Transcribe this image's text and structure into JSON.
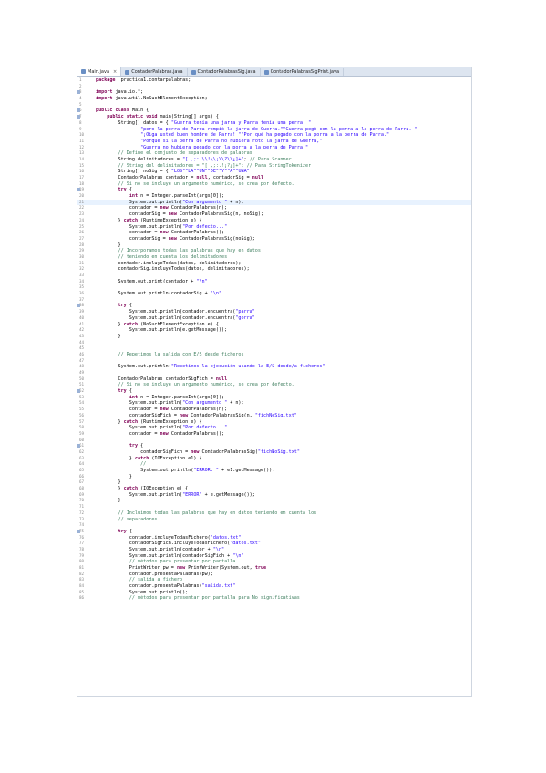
{
  "tabs": [
    {
      "label": "Main.java",
      "close": "×"
    },
    {
      "label": "ContadorPalabras.java"
    },
    {
      "label": "ContadorPalabrasSig.java"
    },
    {
      "label": "ContadorPalabrasSigPrint.java"
    }
  ],
  "lines": [
    {
      "n": "1",
      "t": [
        [
          "kw",
          "package"
        ],
        [
          "",
          "  practica1.contarpalabras;"
        ]
      ]
    },
    {
      "n": "2",
      "t": []
    },
    {
      "n": "3",
      "t": [
        [
          "kw",
          "import"
        ],
        [
          "",
          " java.io.*;"
        ]
      ],
      "m": true
    },
    {
      "n": "4",
      "t": [
        [
          "kw",
          "import"
        ],
        [
          "",
          " java.util.NoSuchElementException;"
        ]
      ]
    },
    {
      "n": "5",
      "t": []
    },
    {
      "n": "6",
      "t": [
        [
          "kw",
          "public class"
        ],
        [
          "",
          " Main {"
        ]
      ],
      "m": true
    },
    {
      "n": "7",
      "t": [
        [
          "",
          "    "
        ],
        [
          "kw",
          "public static void"
        ],
        [
          "",
          " main(String[] args) {"
        ]
      ],
      "m": true
    },
    {
      "n": "8",
      "t": [
        [
          "",
          "        String[] datos = { "
        ],
        [
          "str",
          "\"Guerra tenía una jarra y Parra tenía una perra. \""
        ],
        [
          ","
        ]
      ]
    },
    {
      "n": "9",
      "t": [
        [
          "",
          "                "
        ],
        [
          "str",
          "\"pero la perra de Parra rompió la jarra de Guerra.\""
        ],
        [
          ", "
        ],
        [
          "str",
          "\"Guerra pegó con la porra a la perra de Parra. \""
        ],
        [
          ","
        ]
      ]
    },
    {
      "n": "10",
      "t": [
        [
          "",
          "                "
        ],
        [
          "str",
          "\"¡Oiga usted buen hombre de Parra! \""
        ],
        [
          ", "
        ],
        [
          "str",
          "\"Por qué ha pegado con la porra a la perra de Parra.\""
        ],
        [
          ","
        ]
      ]
    },
    {
      "n": "11",
      "t": [
        [
          "",
          "                "
        ],
        [
          "str",
          "\"Porque si la perra de Parra no hubiera roto la jarra de Guerra,\""
        ],
        [
          ","
        ]
      ]
    },
    {
      "n": "12",
      "t": [
        [
          "",
          "                "
        ],
        [
          "str",
          "\"Guerra no hubiera pegado con la porra a la perra de Parra.\""
        ],
        [
          " };"
        ]
      ]
    },
    {
      "n": "13",
      "t": [
        [
          "cm",
          "        // Define el conjunto de separadores de palabras"
        ]
      ]
    },
    {
      "n": "14",
      "t": [
        [
          "",
          "        String delimitadores = "
        ],
        [
          "str",
          "\"[ ,;:.\\\\!\\\\¡\\\\?\\\\¿]+\""
        ],
        [
          "",
          "; "
        ],
        [
          "cm",
          "// Para Scanner"
        ]
      ]
    },
    {
      "n": "15",
      "t": [
        [
          "cm",
          "        // String del delimitadores = \"[ ,;:.!¡?¿]+\"; // Para StringTokenizer"
        ]
      ]
    },
    {
      "n": "16",
      "t": [
        [
          "",
          "        String[] noSig = { "
        ],
        [
          "str",
          "\"LOS\""
        ],
        [
          ", "
        ],
        [
          "str",
          "\"LA\""
        ],
        [
          ", "
        ],
        [
          "str",
          "\"UN\""
        ],
        [
          ", "
        ],
        [
          "str",
          "\"DE\""
        ],
        [
          ", "
        ],
        [
          "str",
          "\"Y\""
        ],
        [
          ", "
        ],
        [
          "str",
          "\"A\""
        ],
        [
          ", "
        ],
        [
          "str",
          "\"UNA\""
        ],
        [
          " };"
        ]
      ]
    },
    {
      "n": "17",
      "t": [
        [
          "",
          "        ContadorPalabras contador = "
        ],
        [
          "kw",
          "null"
        ],
        [
          "",
          ", contadorSig = "
        ],
        [
          "kw",
          "null"
        ],
        [
          ";"
        ]
      ]
    },
    {
      "n": "18",
      "t": [
        [
          "cm",
          "        // Si no se incluye un argumento numérico, se crea por defecto."
        ]
      ]
    },
    {
      "n": "19",
      "t": [
        [
          "",
          "        "
        ],
        [
          "kw",
          "try"
        ],
        [
          "",
          " {"
        ]
      ],
      "m": true
    },
    {
      "n": "20",
      "t": [
        [
          "",
          "            "
        ],
        [
          "kw",
          "int"
        ],
        [
          "",
          " n = Integer.parseInt(args[0]);"
        ]
      ]
    },
    {
      "n": "21",
      "t": [
        [
          "",
          "            System.out.println("
        ],
        [
          "str",
          "\"Con argumento \""
        ],
        [
          "",
          " + n);"
        ]
      ],
      "hl": true
    },
    {
      "n": "22",
      "t": [
        [
          "",
          "            contador = "
        ],
        [
          "kw",
          "new"
        ],
        [
          "",
          " ContadorPalabras(n);"
        ]
      ]
    },
    {
      "n": "23",
      "t": [
        [
          "",
          "            contadorSig = "
        ],
        [
          "kw",
          "new"
        ],
        [
          "",
          " ContadorPalabrasSig(n, noSig);"
        ]
      ]
    },
    {
      "n": "24",
      "t": [
        [
          "",
          "        } "
        ],
        [
          "kw",
          "catch"
        ],
        [
          "",
          " (RuntimeException e) {"
        ]
      ]
    },
    {
      "n": "25",
      "t": [
        [
          "",
          "            System.out.println("
        ],
        [
          "str",
          "\"Por defecto...\""
        ],
        [
          ");"
        ]
      ]
    },
    {
      "n": "26",
      "t": [
        [
          "",
          "            contador = "
        ],
        [
          "kw",
          "new"
        ],
        [
          "",
          " ContadorPalabras();"
        ]
      ]
    },
    {
      "n": "27",
      "t": [
        [
          "",
          "            contadorSig = "
        ],
        [
          "kw",
          "new"
        ],
        [
          "",
          " ContadorPalabrasSig(noSig);"
        ]
      ]
    },
    {
      "n": "28",
      "t": [
        [
          "",
          "        }"
        ]
      ]
    },
    {
      "n": "29",
      "t": [
        [
          "cm",
          "        // Incorporamos todas las palabras que hay en datos"
        ]
      ]
    },
    {
      "n": "30",
      "t": [
        [
          "cm",
          "        // teniendo en cuenta los delimitadores"
        ]
      ]
    },
    {
      "n": "31",
      "t": [
        [
          "",
          "        contador.incluyeTodas(datos, delimitadores);"
        ]
      ]
    },
    {
      "n": "32",
      "t": [
        [
          "",
          "        contadorSig.incluyeTodas(datos, delimitadores);"
        ]
      ]
    },
    {
      "n": "33",
      "t": []
    },
    {
      "n": "34",
      "t": [
        [
          "",
          "        System.out.print(contador + "
        ],
        [
          "str",
          "\"\\n\""
        ],
        [
          ");"
        ]
      ]
    },
    {
      "n": "35",
      "t": []
    },
    {
      "n": "36",
      "t": [
        [
          "",
          "        System.out.println(contadorSig + "
        ],
        [
          "str",
          "\"\\n\""
        ],
        [
          ");"
        ]
      ]
    },
    {
      "n": "37",
      "t": []
    },
    {
      "n": "38",
      "t": [
        [
          "",
          "        "
        ],
        [
          "kw",
          "try"
        ],
        [
          "",
          " {"
        ]
      ],
      "m": true
    },
    {
      "n": "39",
      "t": [
        [
          "",
          "            System.out.println(contador.encuentra("
        ],
        [
          "str",
          "\"parra\""
        ],
        [
          "));"
        ]
      ]
    },
    {
      "n": "40",
      "t": [
        [
          "",
          "            System.out.println(contador.encuentra("
        ],
        [
          "str",
          "\"gorra\""
        ],
        [
          "));"
        ]
      ]
    },
    {
      "n": "41",
      "t": [
        [
          "",
          "        } "
        ],
        [
          "kw",
          "catch"
        ],
        [
          "",
          " (NoSuchElementException e) {"
        ]
      ]
    },
    {
      "n": "42",
      "t": [
        [
          "",
          "            System.out.println(e.getMessage());"
        ]
      ]
    },
    {
      "n": "43",
      "t": [
        [
          "",
          "        }"
        ]
      ]
    },
    {
      "n": "44",
      "t": []
    },
    {
      "n": "45",
      "t": []
    },
    {
      "n": "46",
      "t": [
        [
          "cm",
          "        // Repetimos la salida con E/S desde ficheros"
        ]
      ]
    },
    {
      "n": "47",
      "t": []
    },
    {
      "n": "48",
      "t": [
        [
          "",
          "        System.out.println("
        ],
        [
          "str",
          "\"Repetimos la ejecución usando la E/S desde/a ficheros\""
        ],
        [
          ");"
        ]
      ]
    },
    {
      "n": "49",
      "t": []
    },
    {
      "n": "50",
      "t": [
        [
          "",
          "        ContadorPalabras contadorSigFich = "
        ],
        [
          "kw",
          "null"
        ],
        [
          ";"
        ]
      ]
    },
    {
      "n": "51",
      "t": [
        [
          "cm",
          "        // Si no se incluye un argumento numérico, se crea por defecto."
        ]
      ]
    },
    {
      "n": "52",
      "t": [
        [
          "",
          "        "
        ],
        [
          "kw",
          "try"
        ],
        [
          "",
          " {"
        ]
      ],
      "m": true
    },
    {
      "n": "53",
      "t": [
        [
          "",
          "            "
        ],
        [
          "kw",
          "int"
        ],
        [
          "",
          " n = Integer.parseInt(args[0]);"
        ]
      ]
    },
    {
      "n": "54",
      "t": [
        [
          "",
          "            System.out.println("
        ],
        [
          "str",
          "\"Con argumento \""
        ],
        [
          "",
          " + n);"
        ]
      ]
    },
    {
      "n": "55",
      "t": [
        [
          "",
          "            contador = "
        ],
        [
          "kw",
          "new"
        ],
        [
          "",
          " ContadorPalabras(n);"
        ]
      ]
    },
    {
      "n": "56",
      "t": [
        [
          "",
          "            contadorSigFich = "
        ],
        [
          "kw",
          "new"
        ],
        [
          "",
          " ContadorPalabrasSig(n, "
        ],
        [
          "str",
          "\"fichNoSig.txt\""
        ],
        [
          ", delimitadores);"
        ]
      ]
    },
    {
      "n": "57",
      "t": [
        [
          "",
          "        } "
        ],
        [
          "kw",
          "catch"
        ],
        [
          "",
          " (RuntimeException e) {"
        ]
      ]
    },
    {
      "n": "58",
      "t": [
        [
          "",
          "            System.out.println("
        ],
        [
          "str",
          "\"Por defecto...\""
        ],
        [
          ");"
        ]
      ]
    },
    {
      "n": "59",
      "t": [
        [
          "",
          "            contador = "
        ],
        [
          "kw",
          "new"
        ],
        [
          "",
          " ContadorPalabras();"
        ]
      ]
    },
    {
      "n": "60",
      "t": []
    },
    {
      "n": "61",
      "t": [
        [
          "",
          "            "
        ],
        [
          "kw",
          "try"
        ],
        [
          "",
          " {"
        ]
      ],
      "m": true
    },
    {
      "n": "62",
      "t": [
        [
          "",
          "                contadorSigFich = "
        ],
        [
          "kw",
          "new"
        ],
        [
          "",
          " ContadorPalabrasSig("
        ],
        [
          "str",
          "\"fichNoSig.txt\""
        ],
        [
          ", delimitadores);"
        ]
      ]
    },
    {
      "n": "63",
      "t": [
        [
          "",
          "            } "
        ],
        [
          "kw",
          "catch"
        ],
        [
          "",
          " (IOException e1) {"
        ]
      ]
    },
    {
      "n": "64",
      "t": [
        [
          "cm",
          "                //"
        ]
      ]
    },
    {
      "n": "65",
      "t": [
        [
          "",
          "                System.out.println("
        ],
        [
          "str",
          "\"ERROR: \""
        ],
        [
          "",
          " + e1.getMessage());"
        ]
      ]
    },
    {
      "n": "66",
      "t": [
        [
          "",
          "            }"
        ]
      ]
    },
    {
      "n": "67",
      "t": [
        [
          "",
          "        }"
        ]
      ]
    },
    {
      "n": "68",
      "t": [
        [
          "",
          "        } "
        ],
        [
          "kw",
          "catch"
        ],
        [
          "",
          " (IOException e) {"
        ]
      ]
    },
    {
      "n": "69",
      "t": [
        [
          "",
          "            System.out.println("
        ],
        [
          "str",
          "\"ERROR\""
        ],
        [
          "",
          " + e.getMessage());"
        ]
      ]
    },
    {
      "n": "70",
      "t": [
        [
          "",
          "        }"
        ]
      ]
    },
    {
      "n": "71",
      "t": []
    },
    {
      "n": "72",
      "t": [
        [
          "cm",
          "        // Incluimos todas las palabras que hay en datos teniendo en cuenta los"
        ]
      ]
    },
    {
      "n": "73",
      "t": [
        [
          "cm",
          "        // separadores"
        ]
      ]
    },
    {
      "n": "74",
      "t": []
    },
    {
      "n": "75",
      "t": [
        [
          "",
          "        "
        ],
        [
          "kw",
          "try"
        ],
        [
          "",
          " {"
        ]
      ],
      "m": true
    },
    {
      "n": "76",
      "t": [
        [
          "",
          "            contador.incluyeTodasFichero("
        ],
        [
          "str",
          "\"datos.txt\""
        ],
        [
          ", delimitadores);"
        ]
      ]
    },
    {
      "n": "77",
      "t": [
        [
          "",
          "            contadorSigFich.incluyeTodasFichero("
        ],
        [
          "str",
          "\"datos.txt\""
        ],
        [
          ", delimitadores);"
        ]
      ]
    },
    {
      "n": "78",
      "t": [
        [
          "",
          "            System.out.println(contador + "
        ],
        [
          "str",
          "\"\\n\""
        ],
        [
          ");"
        ]
      ]
    },
    {
      "n": "79",
      "t": [
        [
          "",
          "            System.out.println(contadorSigFich + "
        ],
        [
          "str",
          "\"\\n\""
        ],
        [
          ");"
        ]
      ]
    },
    {
      "n": "80",
      "t": [
        [
          "cm",
          "            // métodos para presentar por pantalla"
        ]
      ]
    },
    {
      "n": "81",
      "t": [
        [
          "",
          "            PrintWriter pw = "
        ],
        [
          "kw",
          "new"
        ],
        [
          "",
          " PrintWriter(System.out, "
        ],
        [
          "kw",
          "true"
        ],
        [
          ");"
        ]
      ]
    },
    {
      "n": "82",
      "t": [
        [
          "",
          "            contador.presentaPalabras(pw);"
        ]
      ]
    },
    {
      "n": "83",
      "t": [
        [
          "cm",
          "            // salida a fichero"
        ]
      ]
    },
    {
      "n": "84",
      "t": [
        [
          "",
          "            contador.presentaPalabras("
        ],
        [
          "str",
          "\"salida.txt\""
        ],
        [
          ");"
        ]
      ]
    },
    {
      "n": "85",
      "t": [
        [
          "",
          "            System.out.println();"
        ]
      ]
    },
    {
      "n": "86",
      "t": [
        [
          "cm",
          "            // métodos para presentar por pantalla para No significativas"
        ]
      ]
    }
  ]
}
